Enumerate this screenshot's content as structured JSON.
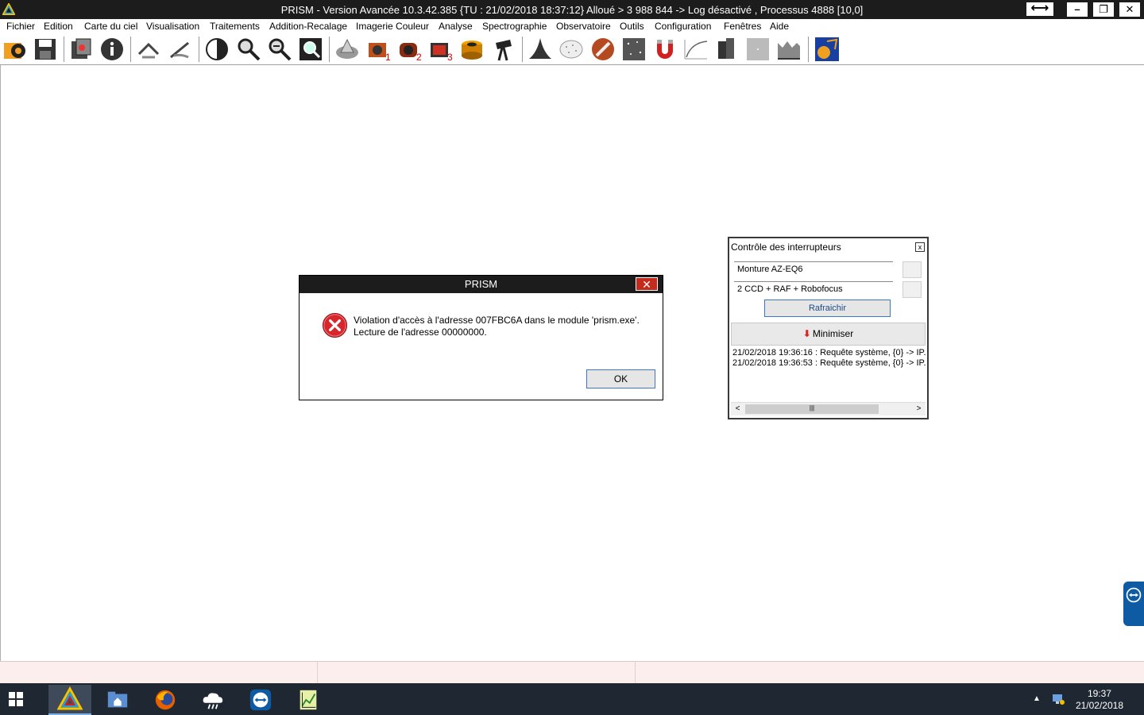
{
  "window": {
    "title": "PRISM - Version Avancée  10.3.42.385   {TU : 21/02/2018 18:37:12} Alloué > 3 988 844 -> Log désactivé , Processus 4888 [10,0]",
    "minimize_glyph": "–",
    "restore_glyph": "❐",
    "close_glyph": "✕",
    "arrows_glyph": "⟷"
  },
  "menu": [
    "Fichier",
    "Edition",
    "Carte du ciel",
    "Visualisation",
    "Traitements",
    "Addition-Recalage",
    "Imagerie Couleur",
    "Analyse",
    "Spectrographie",
    "Observatoire",
    "Outils",
    "Configuration",
    "Fenêtres",
    "Aide"
  ],
  "toolbar_icons": [
    "open-icon",
    "save-icon",
    "batch-icon",
    "info-icon",
    "flip-icon",
    "rotate-icon",
    "contrast-icon",
    "zoom-in-icon",
    "zoom-out-icon",
    "zoom-fit-icon",
    "aperture-icon",
    "camera-1-icon",
    "camera-2-icon",
    "camera-3-icon",
    "filter-wheel-icon",
    "telescope-icon",
    "cone-icon",
    "sphere-icon",
    "tool-icon",
    "star-catalog-icon",
    "magnet-icon",
    "curve-icon",
    "mount-icon",
    "blank-icon",
    "histogram-icon",
    "observatory-icon"
  ],
  "dialog": {
    "title": "PRISM",
    "close_glyph": "✕",
    "line1": "Violation d'accès à l'adresse 007FBC6A dans le module 'prism.exe'.",
    "line2": "Lecture de l'adresse 00000000.",
    "ok_label": "OK"
  },
  "panel": {
    "title": "Contrôle des interrupteurs",
    "close_glyph": "x",
    "field1": "Monture AZ-EQ6",
    "field2": "2 CCD + RAF + Robofocus",
    "refresh_label": "Rafraichir",
    "minimize_label": "Minimiser",
    "log": [
      "21/02/2018 19:36:16 : Requête système,  {0} -> IP.",
      "21/02/2018 19:36:53 : Requête système,  {0} -> IP."
    ],
    "scroll_left": "<",
    "scroll_right": ">",
    "scroll_grip": "|||"
  },
  "taskbar": {
    "time": "19:37",
    "date": "21/02/2018",
    "tray_arrow": "▲",
    "apps": [
      "prism-icon",
      "file-explorer-icon",
      "firefox-icon",
      "weather-icon",
      "teamviewer-icon",
      "notepad-chart-icon"
    ]
  },
  "colors": {
    "titlebar": "#1c1c1c",
    "taskbar": "#1f2733",
    "statusbar": "#fdeeee",
    "dialog_close": "#c42b1c"
  }
}
